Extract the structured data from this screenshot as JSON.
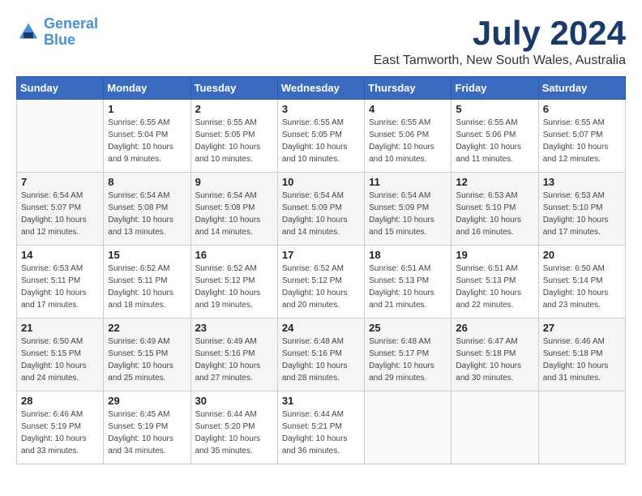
{
  "header": {
    "logo_line1": "General",
    "logo_line2": "Blue",
    "month": "July 2024",
    "location": "East Tamworth, New South Wales, Australia"
  },
  "calendar": {
    "days_of_week": [
      "Sunday",
      "Monday",
      "Tuesday",
      "Wednesday",
      "Thursday",
      "Friday",
      "Saturday"
    ],
    "weeks": [
      [
        {
          "day": "",
          "info": ""
        },
        {
          "day": "1",
          "info": "Sunrise: 6:55 AM\nSunset: 5:04 PM\nDaylight: 10 hours\nand 9 minutes."
        },
        {
          "day": "2",
          "info": "Sunrise: 6:55 AM\nSunset: 5:05 PM\nDaylight: 10 hours\nand 10 minutes."
        },
        {
          "day": "3",
          "info": "Sunrise: 6:55 AM\nSunset: 5:05 PM\nDaylight: 10 hours\nand 10 minutes."
        },
        {
          "day": "4",
          "info": "Sunrise: 6:55 AM\nSunset: 5:06 PM\nDaylight: 10 hours\nand 10 minutes."
        },
        {
          "day": "5",
          "info": "Sunrise: 6:55 AM\nSunset: 5:06 PM\nDaylight: 10 hours\nand 11 minutes."
        },
        {
          "day": "6",
          "info": "Sunrise: 6:55 AM\nSunset: 5:07 PM\nDaylight: 10 hours\nand 12 minutes."
        }
      ],
      [
        {
          "day": "7",
          "info": "Sunrise: 6:54 AM\nSunset: 5:07 PM\nDaylight: 10 hours\nand 12 minutes."
        },
        {
          "day": "8",
          "info": "Sunrise: 6:54 AM\nSunset: 5:08 PM\nDaylight: 10 hours\nand 13 minutes."
        },
        {
          "day": "9",
          "info": "Sunrise: 6:54 AM\nSunset: 5:08 PM\nDaylight: 10 hours\nand 14 minutes."
        },
        {
          "day": "10",
          "info": "Sunrise: 6:54 AM\nSunset: 5:09 PM\nDaylight: 10 hours\nand 14 minutes."
        },
        {
          "day": "11",
          "info": "Sunrise: 6:54 AM\nSunset: 5:09 PM\nDaylight: 10 hours\nand 15 minutes."
        },
        {
          "day": "12",
          "info": "Sunrise: 6:53 AM\nSunset: 5:10 PM\nDaylight: 10 hours\nand 16 minutes."
        },
        {
          "day": "13",
          "info": "Sunrise: 6:53 AM\nSunset: 5:10 PM\nDaylight: 10 hours\nand 17 minutes."
        }
      ],
      [
        {
          "day": "14",
          "info": "Sunrise: 6:53 AM\nSunset: 5:11 PM\nDaylight: 10 hours\nand 17 minutes."
        },
        {
          "day": "15",
          "info": "Sunrise: 6:52 AM\nSunset: 5:11 PM\nDaylight: 10 hours\nand 18 minutes."
        },
        {
          "day": "16",
          "info": "Sunrise: 6:52 AM\nSunset: 5:12 PM\nDaylight: 10 hours\nand 19 minutes."
        },
        {
          "day": "17",
          "info": "Sunrise: 6:52 AM\nSunset: 5:12 PM\nDaylight: 10 hours\nand 20 minutes."
        },
        {
          "day": "18",
          "info": "Sunrise: 6:51 AM\nSunset: 5:13 PM\nDaylight: 10 hours\nand 21 minutes."
        },
        {
          "day": "19",
          "info": "Sunrise: 6:51 AM\nSunset: 5:13 PM\nDaylight: 10 hours\nand 22 minutes."
        },
        {
          "day": "20",
          "info": "Sunrise: 6:50 AM\nSunset: 5:14 PM\nDaylight: 10 hours\nand 23 minutes."
        }
      ],
      [
        {
          "day": "21",
          "info": "Sunrise: 6:50 AM\nSunset: 5:15 PM\nDaylight: 10 hours\nand 24 minutes."
        },
        {
          "day": "22",
          "info": "Sunrise: 6:49 AM\nSunset: 5:15 PM\nDaylight: 10 hours\nand 25 minutes."
        },
        {
          "day": "23",
          "info": "Sunrise: 6:49 AM\nSunset: 5:16 PM\nDaylight: 10 hours\nand 27 minutes."
        },
        {
          "day": "24",
          "info": "Sunrise: 6:48 AM\nSunset: 5:16 PM\nDaylight: 10 hours\nand 28 minutes."
        },
        {
          "day": "25",
          "info": "Sunrise: 6:48 AM\nSunset: 5:17 PM\nDaylight: 10 hours\nand 29 minutes."
        },
        {
          "day": "26",
          "info": "Sunrise: 6:47 AM\nSunset: 5:18 PM\nDaylight: 10 hours\nand 30 minutes."
        },
        {
          "day": "27",
          "info": "Sunrise: 6:46 AM\nSunset: 5:18 PM\nDaylight: 10 hours\nand 31 minutes."
        }
      ],
      [
        {
          "day": "28",
          "info": "Sunrise: 6:46 AM\nSunset: 5:19 PM\nDaylight: 10 hours\nand 33 minutes."
        },
        {
          "day": "29",
          "info": "Sunrise: 6:45 AM\nSunset: 5:19 PM\nDaylight: 10 hours\nand 34 minutes."
        },
        {
          "day": "30",
          "info": "Sunrise: 6:44 AM\nSunset: 5:20 PM\nDaylight: 10 hours\nand 35 minutes."
        },
        {
          "day": "31",
          "info": "Sunrise: 6:44 AM\nSunset: 5:21 PM\nDaylight: 10 hours\nand 36 minutes."
        },
        {
          "day": "",
          "info": ""
        },
        {
          "day": "",
          "info": ""
        },
        {
          "day": "",
          "info": ""
        }
      ]
    ]
  }
}
